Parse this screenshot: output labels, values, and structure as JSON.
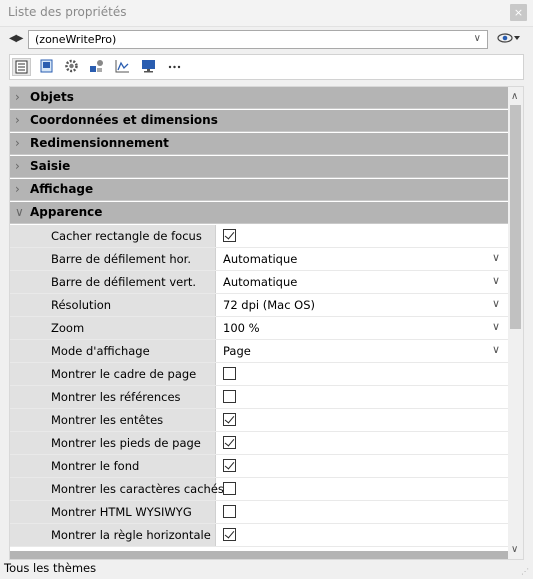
{
  "window": {
    "title": "Liste des propriétés",
    "close_label": "×"
  },
  "object_bar": {
    "selected_object": "(zoneWritePro)"
  },
  "toolbar": {
    "buttons": [
      {
        "icon": "list-view-icon"
      },
      {
        "icon": "form-object-icon"
      },
      {
        "icon": "gear-icon"
      },
      {
        "icon": "shapes-icon"
      },
      {
        "icon": "chart-icon"
      },
      {
        "icon": "monitor-icon"
      },
      {
        "icon": "more-icon"
      }
    ]
  },
  "categories_collapsed": [
    "Objets",
    "Coordonnées et dimensions",
    "Redimensionnement",
    "Saisie",
    "Affichage"
  ],
  "category_expanded": "Apparence",
  "properties": [
    {
      "name": "Cacher rectangle de focus",
      "type": "checkbox",
      "checked": true
    },
    {
      "name": "Barre de défilement hor.",
      "type": "select",
      "value": "Automatique"
    },
    {
      "name": "Barre de défilement vert.",
      "type": "select",
      "value": "Automatique"
    },
    {
      "name": "Résolution",
      "type": "select",
      "value": "72 dpi (Mac OS)"
    },
    {
      "name": "Zoom",
      "type": "select",
      "value": "100 %"
    },
    {
      "name": "Mode d'affichage",
      "type": "select",
      "value": "Page"
    },
    {
      "name": "Montrer le cadre de page",
      "type": "checkbox",
      "checked": false
    },
    {
      "name": "Montrer les références",
      "type": "checkbox",
      "checked": false
    },
    {
      "name": "Montrer les entêtes",
      "type": "checkbox",
      "checked": true
    },
    {
      "name": "Montrer les pieds de page",
      "type": "checkbox",
      "checked": true
    },
    {
      "name": "Montrer le fond",
      "type": "checkbox",
      "checked": true
    },
    {
      "name": "Montrer les caractères cachés",
      "type": "checkbox",
      "checked": false
    },
    {
      "name": "Montrer HTML WYSIWYG",
      "type": "checkbox",
      "checked": false
    },
    {
      "name": "Montrer la règle horizontale",
      "type": "checkbox",
      "checked": true
    }
  ],
  "status": {
    "text": "Tous les thèmes"
  },
  "colors": {
    "category_bg": "#b4b4b4",
    "name_cell_bg": "#e1e1e1",
    "value_cell_bg": "#ffffff"
  }
}
